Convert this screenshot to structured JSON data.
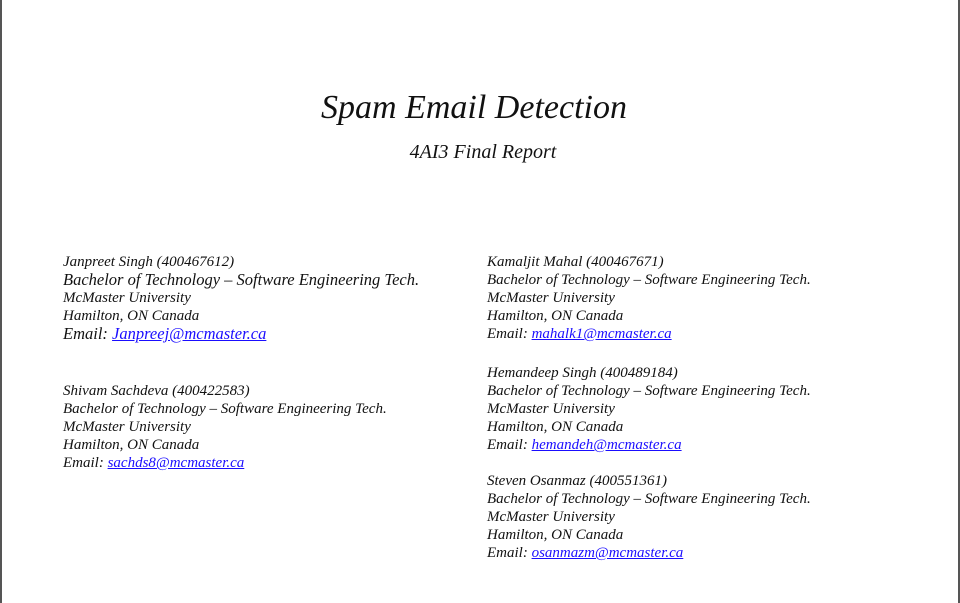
{
  "document": {
    "title": "Spam Email Detection",
    "subtitle": "4AI3 Final Report"
  },
  "authors": [
    {
      "name": "Janpreet Singh (400467612)",
      "degree": "Bachelor of Technology – Software Engineering Tech.",
      "university": "McMaster University",
      "location": "Hamilton, ON Canada",
      "email_label": "Email: ",
      "email": "Janpreej@mcmaster.ca"
    },
    {
      "name": "Shivam Sachdeva (400422583)",
      "degree": "Bachelor of Technology – Software Engineering Tech.",
      "university": "McMaster University",
      "location": "Hamilton, ON Canada",
      "email_label": "Email: ",
      "email": "sachds8@mcmaster.ca"
    },
    {
      "name": "Kamaljit Mahal (400467671)",
      "degree": "Bachelor of Technology – Software Engineering Tech.",
      "university": "McMaster University",
      "location": "Hamilton, ON Canada",
      "email_label": "Email: ",
      "email": "mahalk1@mcmaster.ca"
    },
    {
      "name": "Hemandeep Singh (400489184)",
      "degree": "Bachelor of Technology – Software Engineering Tech.",
      "university": "McMaster University",
      "location": "Hamilton, ON Canada",
      "email_label": "Email: ",
      "email": "hemandeh@mcmaster.ca"
    },
    {
      "name": "Steven Osanmaz (400551361)",
      "degree": "Bachelor of Technology – Software Engineering Tech.",
      "university": "McMaster University",
      "location": "Hamilton, ON Canada",
      "email_label": "Email: ",
      "email": "osanmazm@mcmaster.ca"
    }
  ],
  "colors": {
    "link": "#1a0dff",
    "text": "#111111",
    "border": "#555555"
  }
}
